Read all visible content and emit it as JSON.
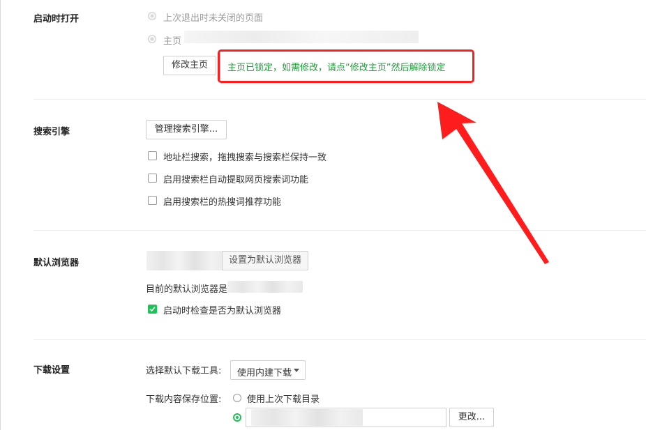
{
  "startup": {
    "title": "启动时打开",
    "option_last_session": "上次退出时未关闭的页面",
    "option_homepage": "主页",
    "modify_homepage_button": "修改主页",
    "lock_notice": "主页已锁定，如需修改，请点“修改主页”然后解除锁定"
  },
  "search": {
    "title": "搜索引擎",
    "manage_button": "管理搜索引擎...",
    "options": [
      {
        "label": "地址栏搜索，拖拽搜索与搜索栏保持一致",
        "checked": false
      },
      {
        "label": "启用搜索栏自动提取网页搜索词功能",
        "checked": false
      },
      {
        "label": "启用搜索栏的热搜词推荐功能",
        "checked": false
      }
    ]
  },
  "default_browser": {
    "title": "默认浏览器",
    "set_default_button": "设置为默认浏览器",
    "current_label": "目前的默认浏览器是",
    "check_on_startup": "启动时检查是否为默认浏览器",
    "check_on_startup_checked": true
  },
  "download": {
    "title": "下载设置",
    "tool_label": "选择默认下载工具:",
    "tool_selected": "使用内建下载",
    "location_label": "下载内容保存位置:",
    "location_last_dir": "使用上次下载目录",
    "change_button": "更改..."
  },
  "colors": {
    "accent": "#21c05a",
    "notice_text": "#1f9b3a",
    "annotation_red": "#ff1c1c"
  }
}
